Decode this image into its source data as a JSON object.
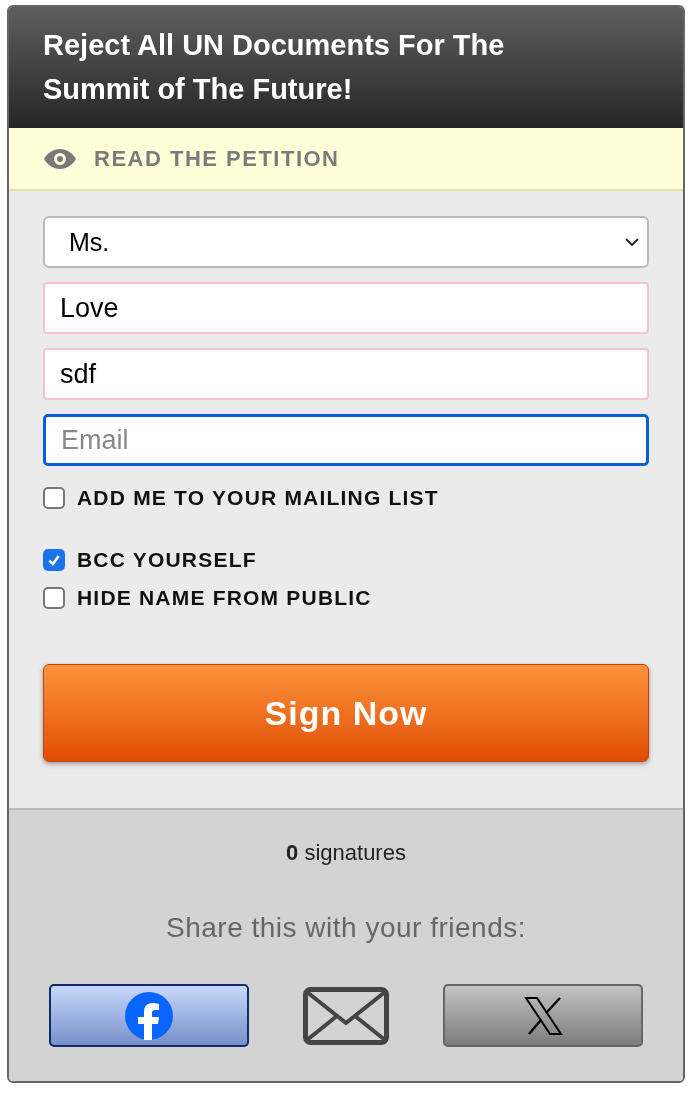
{
  "title": "Reject All UN Documents For The Summit of The Future!",
  "read_link": "READ THE PETITION",
  "fields": [
    {
      "kind": "select",
      "value": "Ms.",
      "invalid": false,
      "focused": false
    },
    {
      "kind": "input",
      "value": "Love",
      "invalid": true,
      "focused": false
    },
    {
      "kind": "input",
      "value": "sdf",
      "invalid": true,
      "focused": false
    },
    {
      "kind": "input",
      "placeholder": "Email",
      "invalid": false,
      "focused": true
    }
  ],
  "checkboxes": [
    {
      "label": "ADD ME TO YOUR MAILING LIST",
      "checked": false
    },
    {
      "label": "BCC YOURSELF",
      "checked": true
    },
    {
      "label": "HIDE NAME FROM PUBLIC",
      "checked": false
    }
  ],
  "sign_button": "Sign Now",
  "signatures": "**0** signatures",
  "share_text": "Share this with your friends:",
  "share_buttons": [
    {
      "kind": "facebook"
    },
    {
      "kind": "email"
    },
    {
      "kind": "x"
    }
  ]
}
